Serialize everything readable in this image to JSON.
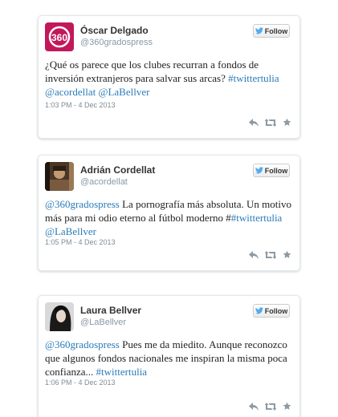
{
  "follow_label": "Follow",
  "colors": {
    "link": "#2b7bb9",
    "handle": "#8899a6",
    "bird": "#55acee"
  },
  "tweets": [
    {
      "author": "Óscar Delgado",
      "handle": "@360gradospress",
      "avatar_text": "360",
      "text_parts": [
        {
          "text": "¿Qué os parece que los clubes recurran a fondos de inversión extranjeros para salvar sus arcas? ",
          "link": false
        },
        {
          "text": "#twittertulia",
          "link": true
        },
        {
          "text": " ",
          "link": false
        },
        {
          "text": "@acordellat",
          "link": true
        },
        {
          "text": " ",
          "link": false
        },
        {
          "text": "@LaBellver",
          "link": true
        }
      ],
      "time": "1:03 PM - 4 Dec 2013"
    },
    {
      "author": "Adrián Cordellat",
      "handle": "@acordellat",
      "text_parts": [
        {
          "text": "@360gradospress",
          "link": true
        },
        {
          "text": " La pornografía más absoluta. Un motivo más para mi odio eterno al fútbol moderno #",
          "link": false
        },
        {
          "text": "#twittertulia",
          "link": true
        },
        {
          "text": " ",
          "link": false
        },
        {
          "text": "@LaBellver",
          "link": true
        }
      ],
      "time": "1:05 PM - 4 Dec 2013"
    },
    {
      "author": "Laura Bellver",
      "handle": "@LaBellver",
      "text_parts": [
        {
          "text": "@360gradospress",
          "link": true
        },
        {
          "text": " Pues me da miedito. Aunque reconozco que algunos fondos nacionales me inspiran la misma poca confianza... ",
          "link": false
        },
        {
          "text": "#twittertulia",
          "link": true
        }
      ],
      "time": "1:06 PM - 4 Dec 2013"
    }
  ]
}
